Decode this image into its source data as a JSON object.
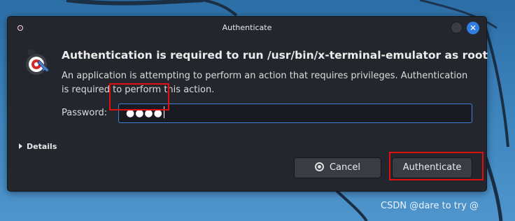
{
  "dialog": {
    "window_title": "Authenticate",
    "close_glyph": "✕",
    "heading": "Authentication is required to run /usr/bin/x-terminal-emulator as root",
    "description": "An application is attempting to perform an action that requires privileges. Authentication is required to perform this action.",
    "password_label": "Password:",
    "password_masked": "●●●●",
    "details_label": "Details",
    "cancel_label": "Cancel",
    "authenticate_label": "Authenticate"
  },
  "icons": {
    "app_icon": "kali-dragon-icon",
    "dialog_icon": "authentication-key-icon",
    "minimize_icon": "minimize-icon",
    "close_icon": "close-icon",
    "details_icon": "disclosure-triangle-icon",
    "cancel_icon": "cancel-circle-icon"
  },
  "colors": {
    "accent": "#3f82d9",
    "close_button": "#2f7de0",
    "highlight_annotation": "#e01010",
    "dialog_background": "#24262e"
  },
  "watermark": "CSDN @dare to try @"
}
